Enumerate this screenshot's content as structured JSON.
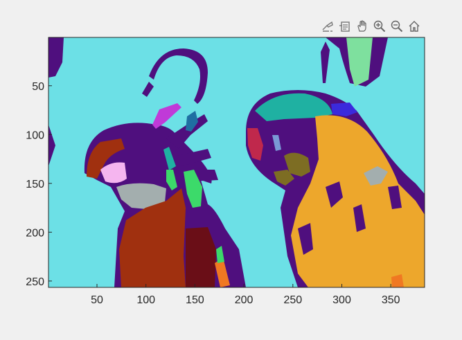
{
  "toolbar": {
    "icons": [
      "data-tips-icon",
      "brush-icon",
      "pan-icon",
      "zoom-in-icon",
      "zoom-out-icon",
      "home-icon"
    ]
  },
  "axes": {
    "xticks": [
      "50",
      "100",
      "150",
      "200",
      "250",
      "300",
      "350"
    ],
    "yticks": [
      "50",
      "100",
      "150",
      "200",
      "250"
    ]
  },
  "chart_data": {
    "type": "heatmap",
    "xlim": [
      0.5,
      384.5
    ],
    "ylim": [
      0.5,
      256.5
    ],
    "x_tick_values": [
      50,
      100,
      150,
      200,
      250,
      300,
      350
    ],
    "y_tick_values": [
      50,
      100,
      150,
      200,
      250
    ],
    "y_direction": "reversed",
    "grid": false,
    "colors": {
      "background": "#6ce0e6",
      "purple": "#4f0f7e",
      "rust": "#a0300f",
      "orange": "#eda72c",
      "olive": "#7d6d23",
      "gray": "#a3aeae",
      "green": "#7ee09e",
      "bright_green": "#3cda6a",
      "teal": "#1fb1a2",
      "magenta": "#c03ad8",
      "pink": "#f5b5ef",
      "crimson": "#c0284c",
      "blue": "#3b2adc",
      "dark_red": "#6a0e17",
      "orange_red": "#f07822"
    }
  }
}
